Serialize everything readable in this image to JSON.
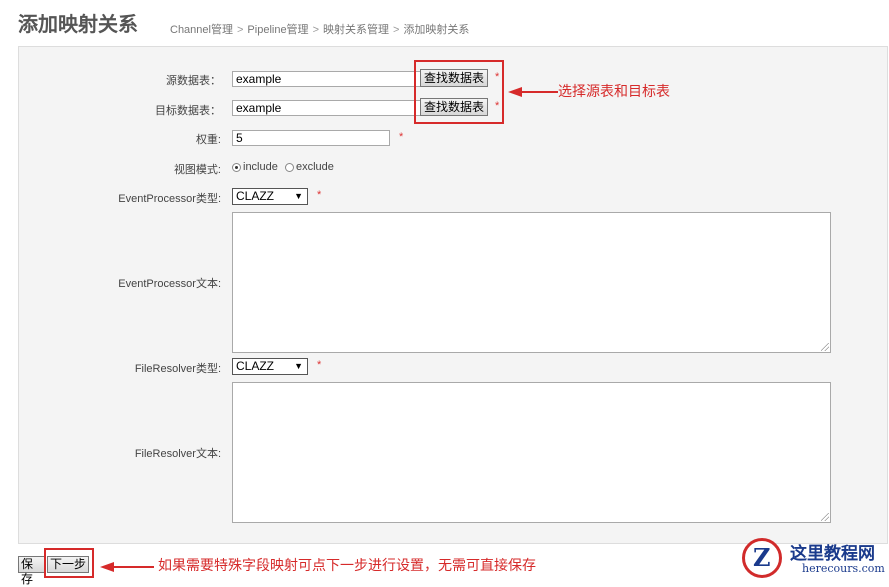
{
  "header": {
    "title": "添加映射关系",
    "breadcrumb": [
      "Channel管理",
      "Pipeline管理",
      "映射关系管理",
      "添加映射关系"
    ]
  },
  "form": {
    "source_table": {
      "label": "源数据表：",
      "value": "example",
      "button": "查找数据表",
      "required": "*"
    },
    "target_table": {
      "label": "目标数据表：",
      "value": "example",
      "button": "查找数据表",
      "required": "*"
    },
    "weight": {
      "label": "权重:",
      "value": "5",
      "required": "*"
    },
    "view_mode": {
      "label": "视图模式:",
      "options": [
        "include",
        "exclude"
      ],
      "selected": "include"
    },
    "event_processor_type": {
      "label": "EventProcessor类型:",
      "value": "CLAZZ",
      "required": "*"
    },
    "event_processor_text": {
      "label": "EventProcessor文本:",
      "value": ""
    },
    "file_resolver_type": {
      "label": "FileResolver类型:",
      "value": "CLAZZ",
      "required": "*"
    },
    "file_resolver_text": {
      "label": "FileResolver文本:",
      "value": ""
    }
  },
  "buttons": {
    "save": "保存",
    "next": "下一步"
  },
  "annotations": {
    "select_tables": "选择源表和目标表",
    "next_step_note": "如果需要特殊字段映射可点下一步进行设置，无需可直接保存"
  },
  "watermark": {
    "logo_letter": "Z",
    "title": "这里教程网",
    "url": "herecours.com"
  },
  "colors": {
    "annotation_red": "#d62a2a",
    "panel_bg": "#f4f4f4",
    "brand_blue": "#1a3a8c"
  }
}
